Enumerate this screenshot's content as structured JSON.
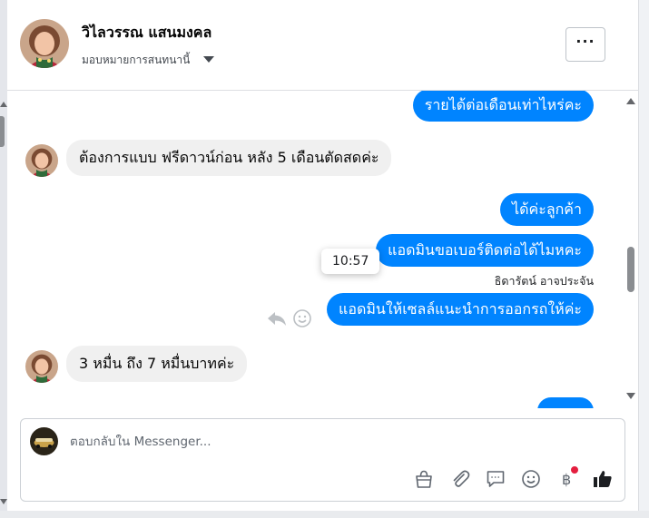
{
  "header": {
    "contact_name": "วิไลวรรณ แสนมงคล",
    "assign_label": "มอบหมายการสนทนานี้",
    "more_label": "···"
  },
  "messages": [
    {
      "direction": "outgoing",
      "text": "รายได้ต่อเดือนเท่าไหร่คะ"
    },
    {
      "direction": "incoming",
      "text": "ต้องการแบบ ฟรีดาวน์ก่อน หลัง 5 เดือนตัดสดค่ะ"
    },
    {
      "direction": "outgoing",
      "text": "ได้ค่ะลูกค้า"
    },
    {
      "direction": "outgoing",
      "text": "แอดมินขอเบอร์ติดต่อได้ไมหคะ"
    },
    {
      "direction": "outgoing",
      "text": "แอดมินให้เซลล์แนะนำการออกรถให้ค่ะ"
    },
    {
      "direction": "incoming",
      "text": "3 หมื่น ถึง 7 หมื่นบาทค่ะ"
    }
  ],
  "sender_name": "ธิดารัตน์ อาจประจัน",
  "tooltip_time": "10:57",
  "composer": {
    "placeholder": "ตอบกลับใน Messenger..."
  },
  "composer_tools": [
    {
      "icon": "bag-icon"
    },
    {
      "icon": "paperclip-icon"
    },
    {
      "icon": "saved-reply-icon"
    },
    {
      "icon": "emoji-icon"
    },
    {
      "icon": "baht-payment-icon",
      "badge": true
    },
    {
      "icon": "thumbs-up-icon"
    }
  ],
  "colors": {
    "outgoing_bubble": "#0084ff",
    "incoming_bubble": "#f0f0f0",
    "notification_dot": "#e41e3f"
  }
}
